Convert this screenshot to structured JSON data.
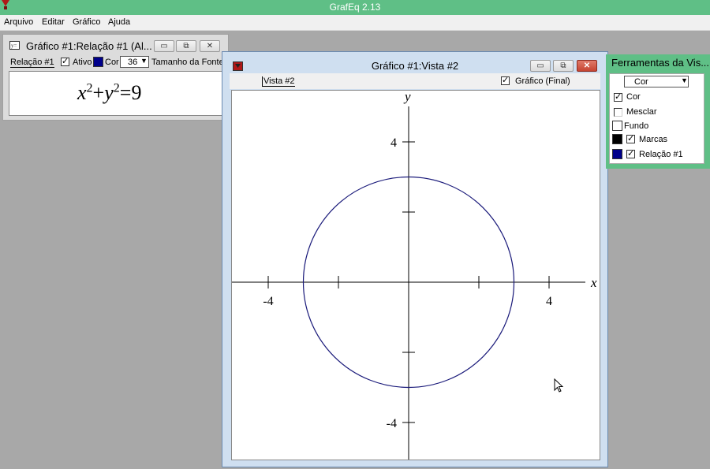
{
  "app": {
    "title": "GrafEq 2.13"
  },
  "menu": {
    "items": [
      "Arquivo",
      "Editar",
      "Gráfico",
      "Ajuda"
    ]
  },
  "relation_window": {
    "title": "Gráfico #1:Relação #1 (Al...",
    "tab_label": "Relação #1",
    "active_label": "Ativo",
    "active_checked": true,
    "color_label": "Cor",
    "color": "#00008b",
    "font_size_value": "36",
    "font_size_label": "Tamanho da Fonte",
    "equation": {
      "base1": "x",
      "exp1": "2",
      "plus": "+",
      "base2": "y",
      "exp2": "2",
      "equals": "=",
      "rhs": "9"
    }
  },
  "view_window": {
    "title": "Gráfico #1:Vista #2",
    "tab_label": "Vista #2",
    "graph_checkbox_label": "Gráfico (Final)",
    "graph_checked": true
  },
  "tools_panel": {
    "title": "Ferramentas da Vis...",
    "dropdown_value": "Cor",
    "items": [
      {
        "label": "Cor",
        "checked": true,
        "swatch": null
      },
      {
        "label": "Mesclar",
        "checked": false,
        "swatch": null
      },
      {
        "label": "Fundo",
        "checked": null,
        "swatch": "#ffffff"
      },
      {
        "label": "Marcas",
        "checked": true,
        "swatch": "#000000"
      },
      {
        "label": "Relação #1",
        "checked": true,
        "swatch": "#00008b"
      }
    ]
  },
  "plot": {
    "x_axis_label": "x",
    "y_axis_label": "y",
    "x_range": [
      -5,
      5
    ],
    "y_range": [
      -5,
      5
    ],
    "x_tick_labels": [
      "-4",
      "4"
    ],
    "y_tick_labels": [
      "4",
      "-4"
    ],
    "curve_color": "#1a1a7a",
    "circle_radius": 3
  }
}
